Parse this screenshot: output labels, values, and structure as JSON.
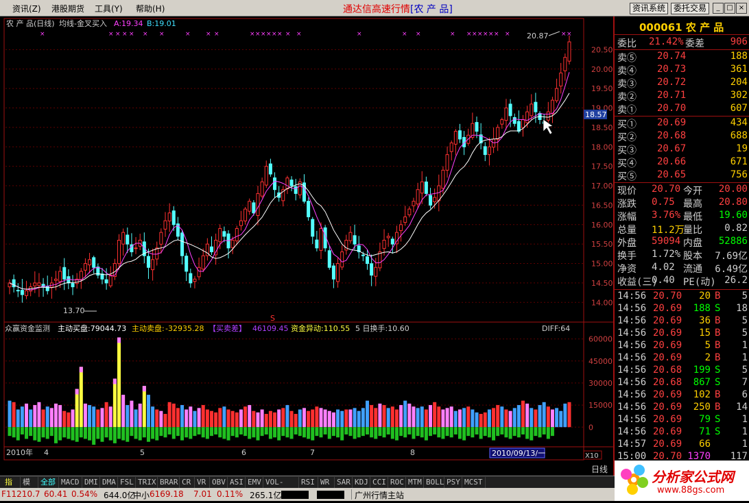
{
  "menu": [
    "资讯(Z)",
    "港股期货",
    "工具(Y)",
    "帮助(H)"
  ],
  "app_title": "通达信高速行情",
  "app_title_stock": "[农 产 品]",
  "top_buttons": [
    "资讯系统",
    "委托交易"
  ],
  "window_buttons": [
    "_",
    "□",
    "×"
  ],
  "chart_header": {
    "name": "农 产 品(日线)",
    "indicator": "均线-金叉买入",
    "a_label": "A:19.34",
    "b_label": "B:19.01"
  },
  "price_high_label": "20.87",
  "price_low_label": "13.70",
  "cross_price": "18.57",
  "signal_mark": "S",
  "bottom_header": {
    "name": "众赢资金监测",
    "buy": "主动买盘:79044.73",
    "sell_label": "主动卖盘:",
    "sell": "-32935.28",
    "diff_label": "【买卖差】",
    "diff": "46109.45",
    "abnormal": "资金异动:110.55",
    "turnover": "5 日换手:10.60",
    "right": "DIFF:64"
  },
  "x_axis": {
    "year": "2010年",
    "months": [
      "4",
      "5",
      "6",
      "7",
      "8"
    ],
    "date_box": "2010/09/13/一",
    "period": "日线",
    "scale": "X10"
  },
  "tabs": [
    "指标",
    "模板",
    "全部",
    "MACD",
    "DMI",
    "DMA",
    "FSL",
    "TRIX",
    "BRAR",
    "CR",
    "VR",
    "OBV",
    "ASI",
    "EMV",
    "VOL-TDX",
    "RSI",
    "WR",
    "SAR",
    "KDJ",
    "CCI",
    "ROC",
    "MTM",
    "BOLL",
    "PSY",
    "MCST"
  ],
  "status": {
    "idx1": "F11210.7",
    "idx1_chg": "60.41",
    "idx1_pct": "0.54%",
    "idx1_amt": "644.0亿",
    "idx2_name": "中小",
    "idx2": "6169.18",
    "idx2_chg": "7.01",
    "idx2_pct": "0.11%",
    "idx2_amt": "265.1亿",
    "server": "广州行情主站"
  },
  "quote": {
    "code": "000061 农 产 品",
    "weibi_label": "委比",
    "weibi": "21.42%",
    "weicha_label": "委差",
    "weicha": "906",
    "asks": [
      {
        "label": "卖⑤",
        "price": "20.74",
        "vol": "188"
      },
      {
        "label": "卖④",
        "price": "20.73",
        "vol": "361"
      },
      {
        "label": "卖③",
        "price": "20.72",
        "vol": "204"
      },
      {
        "label": "卖②",
        "price": "20.71",
        "vol": "302"
      },
      {
        "label": "卖①",
        "price": "20.70",
        "vol": "607"
      }
    ],
    "bids": [
      {
        "label": "买①",
        "price": "20.69",
        "vol": "434"
      },
      {
        "label": "买②",
        "price": "20.68",
        "vol": "688"
      },
      {
        "label": "买③",
        "price": "20.67",
        "vol": "19"
      },
      {
        "label": "买④",
        "price": "20.66",
        "vol": "671"
      },
      {
        "label": "买⑤",
        "price": "20.65",
        "vol": "756"
      }
    ],
    "stats": [
      {
        "l1": "现价",
        "v1": "20.70",
        "c1": "#ff4040",
        "l2": "今开",
        "v2": "20.00",
        "c2": "#ff4040"
      },
      {
        "l1": "涨跌",
        "v1": "0.75",
        "c1": "#ff4040",
        "l2": "最高",
        "v2": "20.80",
        "c2": "#ff4040"
      },
      {
        "l1": "涨幅",
        "v1": "3.76%",
        "c1": "#ff4040",
        "l2": "最低",
        "v2": "19.60",
        "c2": "#00ff00"
      },
      {
        "l1": "总量",
        "v1": "11.2万",
        "c1": "#ffd000",
        "l2": "量比",
        "v2": "0.82",
        "c2": "#d0d0d0"
      },
      {
        "l1": "外盘",
        "v1": "59094",
        "c1": "#ff4040",
        "l2": "内盘",
        "v2": "52886",
        "c2": "#00ff00"
      },
      {
        "l1": "换手",
        "v1": "1.72%",
        "c1": "#d0d0d0",
        "l2": "股本",
        "v2": "7.69亿",
        "c2": "#d0d0d0"
      },
      {
        "l1": "净资",
        "v1": "4.02",
        "c1": "#d0d0d0",
        "l2": "流通",
        "v2": "6.49亿",
        "c2": "#d0d0d0"
      },
      {
        "l1": "收益(三)",
        "v1": "0.40",
        "c1": "#d0d0d0",
        "l2": "PE(动)",
        "v2": "26.2",
        "c2": "#d0d0d0"
      }
    ],
    "ticks": [
      {
        "time": "14:56",
        "price": "20.70",
        "vol": "20",
        "bs": "B",
        "n": "5"
      },
      {
        "time": "14:56",
        "price": "20.69",
        "vol": "188",
        "bs": "S",
        "n": "18"
      },
      {
        "time": "14:56",
        "price": "20.69",
        "vol": "36",
        "bs": "B",
        "n": "5"
      },
      {
        "time": "14:56",
        "price": "20.69",
        "vol": "15",
        "bs": "B",
        "n": "5"
      },
      {
        "time": "14:56",
        "price": "20.69",
        "vol": "5",
        "bs": "B",
        "n": "1"
      },
      {
        "time": "14:56",
        "price": "20.69",
        "vol": "2",
        "bs": "B",
        "n": "1"
      },
      {
        "time": "14:56",
        "price": "20.68",
        "vol": "199",
        "bs": "S",
        "n": "5"
      },
      {
        "time": "14:56",
        "price": "20.68",
        "vol": "867",
        "bs": "S",
        "n": "7"
      },
      {
        "time": "14:56",
        "price": "20.69",
        "vol": "102",
        "bs": "B",
        "n": "6"
      },
      {
        "time": "14:56",
        "price": "20.69",
        "vol": "250",
        "bs": "B",
        "n": "14"
      },
      {
        "time": "14:56",
        "price": "20.69",
        "vol": "79",
        "bs": "S",
        "n": "1"
      },
      {
        "time": "14:56",
        "price": "20.69",
        "vol": "71",
        "bs": "S",
        "n": "1"
      },
      {
        "time": "14:57",
        "price": "20.69",
        "vol": "66",
        "bs": "",
        "n": "1"
      },
      {
        "time": "15:00",
        "price": "20.70",
        "vol": "1370",
        "bs": "",
        "n": "117"
      }
    ]
  },
  "logo": {
    "title": "分析家公式网",
    "url": "www.88gs.com"
  },
  "chart_data": [
    {
      "type": "candlestick",
      "title": "农 产 品(日线)",
      "ylim": [
        13.6,
        21.0
      ],
      "yticks": [
        14.0,
        14.5,
        15.0,
        15.5,
        16.0,
        16.5,
        17.0,
        17.5,
        18.0,
        18.5,
        19.0,
        19.5,
        20.0,
        20.5
      ],
      "high": 20.87,
      "low": 13.7,
      "close_series": [
        14.5,
        14.4,
        14.3,
        14.2,
        14.3,
        14.4,
        14.5,
        14.5,
        14.4,
        14.3,
        14.5,
        14.6,
        14.8,
        14.6,
        14.5,
        14.4,
        14.6,
        14.8,
        15.0,
        15.1,
        14.9,
        14.7,
        14.6,
        14.5,
        14.7,
        15.0,
        15.6,
        15.8,
        15.5,
        15.3,
        15.4,
        15.6,
        15.2,
        14.9,
        15.1,
        15.4,
        15.8,
        16.1,
        16.3,
        16.0,
        15.7,
        15.2,
        14.8,
        14.5,
        14.6,
        14.9,
        15.2,
        15.5,
        15.3,
        15.6,
        15.9,
        15.7,
        15.4,
        15.6,
        15.9,
        16.1,
        16.4,
        16.6,
        16.3,
        16.8,
        17.1,
        17.5,
        17.3,
        16.9,
        16.7,
        16.9,
        17.2,
        17.0,
        16.8,
        17.1,
        16.6,
        16.2,
        15.7,
        15.4,
        15.9,
        15.4,
        14.9,
        14.6,
        15.0,
        15.3,
        15.6,
        15.8,
        15.5,
        15.3,
        15.2,
        15.0,
        14.7,
        14.9,
        15.3,
        15.6,
        15.7,
        15.5,
        15.8,
        16.0,
        16.2,
        16.4,
        16.6,
        16.9,
        17.1,
        16.8,
        16.5,
        16.7,
        17.0,
        17.4,
        17.8,
        18.1,
        18.4,
        18.2,
        18.0,
        18.3,
        18.6,
        18.4,
        18.1,
        17.8,
        18.0,
        18.2,
        18.5,
        18.7,
        19.0,
        18.8,
        18.6,
        18.4,
        18.7,
        18.9,
        19.1,
        18.9,
        18.7,
        18.6,
        18.9,
        19.2,
        19.5,
        19.9,
        20.3,
        20.7
      ],
      "ma_short_color": "#ff40ff",
      "ma_long_color": "#ffffff"
    },
    {
      "type": "bar",
      "title": "众赢资金监测",
      "ylim": [
        -12000,
        64000
      ],
      "yticks": [
        0,
        15000,
        30000,
        45000,
        60000
      ],
      "values": [
        18000,
        17000,
        12000,
        14000,
        16000,
        12000,
        15000,
        17000,
        12000,
        14000,
        13000,
        16000,
        15000,
        11000,
        10000,
        12000,
        26000,
        41000,
        16000,
        15000,
        14000,
        12000,
        13000,
        17000,
        14000,
        33000,
        61000,
        22000,
        15000,
        18000,
        12000,
        16000,
        28000,
        22000,
        14000,
        12000,
        11000,
        9000,
        17000,
        16000,
        13000,
        15000,
        12000,
        14000,
        11000,
        13000,
        15000,
        12000,
        11000,
        10000,
        13000,
        14000,
        12000,
        11000,
        10000,
        12000,
        14000,
        15000,
        11000,
        10000,
        12000,
        9000,
        11000,
        10000,
        12000,
        13000,
        15000,
        11000,
        9000,
        12000,
        13000,
        11000,
        12000,
        14000,
        13000,
        12000,
        11000,
        10000,
        12000,
        11000,
        12000,
        12000,
        13000,
        11000,
        13000,
        18000,
        15000,
        13000,
        16000,
        15000,
        13000,
        14000,
        12000,
        15000,
        18000,
        16000,
        14000,
        13000,
        14000,
        12000,
        15000,
        17000,
        14000,
        12000,
        13000,
        14000,
        11000,
        12000,
        13000,
        14000,
        12000,
        10000,
        9000,
        10000,
        12000,
        13000,
        15000,
        14000,
        12000,
        11000,
        13000,
        15000,
        18000,
        16000,
        13000,
        12000,
        15000,
        17000,
        14000,
        12000,
        13000,
        11000,
        16000,
        17000
      ],
      "neg_values": [
        -6000,
        -7000,
        -9000,
        -5000,
        -8000,
        -6000,
        -9000,
        -10000,
        -7000,
        -8000,
        -6000,
        -11000,
        -9000,
        -7000,
        -8000,
        -9000,
        -10000,
        -7000,
        -8000,
        -9000,
        -12000,
        -8000,
        -10000,
        -7000,
        -9000,
        -11000,
        -8000,
        -9000,
        -10000,
        -6000,
        -8000,
        -9000,
        -7000,
        -10000,
        -8000,
        -9000,
        -6000,
        -7000,
        -5000,
        -8000,
        -6000,
        -9000,
        -7000,
        -8000,
        -6000,
        -5000,
        -7000,
        -8000,
        -6000,
        -5000,
        -7000,
        -8000,
        -9000,
        -6000,
        -7000,
        -5000,
        -6000,
        -8000,
        -7000,
        -9000,
        -6000,
        -5000,
        -8000,
        -7000,
        -9000,
        -6000,
        -7000,
        -8000,
        -5000,
        -6000,
        -7000,
        -8000,
        -9000,
        -6000,
        -7000,
        -5000,
        -8000,
        -6000,
        -7000,
        -9000,
        -5000,
        -6000,
        -8000,
        -7000,
        -6000,
        -5000,
        -7000,
        -8000,
        -6000,
        -7000,
        -5000,
        -8000,
        -9000,
        -6000,
        -7000,
        -5000,
        -8000,
        -6000,
        -7000,
        -9000,
        -6000,
        -5000,
        -7000,
        -8000,
        -6000,
        -7000,
        -5000,
        -8000,
        -9000,
        -6000,
        -7000,
        -5000,
        -8000,
        -6000,
        -7000,
        -9000,
        -6000,
        -5000,
        -7000,
        -8000,
        -6000,
        -7000,
        -5000,
        -8000,
        -9000,
        -6000,
        -7000,
        -5000,
        -8000,
        -6000
      ]
    }
  ]
}
